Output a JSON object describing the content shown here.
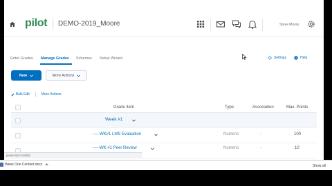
{
  "header": {
    "logo": "pilot",
    "course_title": "DEMO-2019_Moore",
    "user_name": "Steve Moore"
  },
  "nav": {
    "items": [
      "Enter Grades",
      "Manage Grades",
      "Schemes",
      "Setup Wizard"
    ],
    "active": "Manage Grades",
    "settings_label": "Settings",
    "help_label": "Help"
  },
  "actions": {
    "new_label": "New",
    "more_label": "More Actions",
    "bulk_edit_label": "Bulk Edit",
    "more_actions_label": "More Actions"
  },
  "table": {
    "columns": [
      "Grade Item",
      "Type",
      "Association",
      "Max. Points"
    ],
    "rows": [
      {
        "kind": "category",
        "name": "Week #1",
        "type": "",
        "association": "",
        "max_points": ""
      },
      {
        "kind": "item",
        "name": "-----WK#1 LMS Evaluation",
        "type": "Numeric",
        "association": "-",
        "max_points": "100"
      },
      {
        "kind": "item",
        "name": "-----WK #1 Peer Review",
        "type": "Numeric",
        "association": "-",
        "max_points": "10"
      }
    ]
  },
  "status_bar": {
    "text": "javascript:void(0);"
  },
  "download_bar": {
    "file_label": "Week One Content.docx",
    "show_all_label": "Show all"
  },
  "colors": {
    "accent": "#006fbf",
    "logo": "#2e8b57"
  }
}
